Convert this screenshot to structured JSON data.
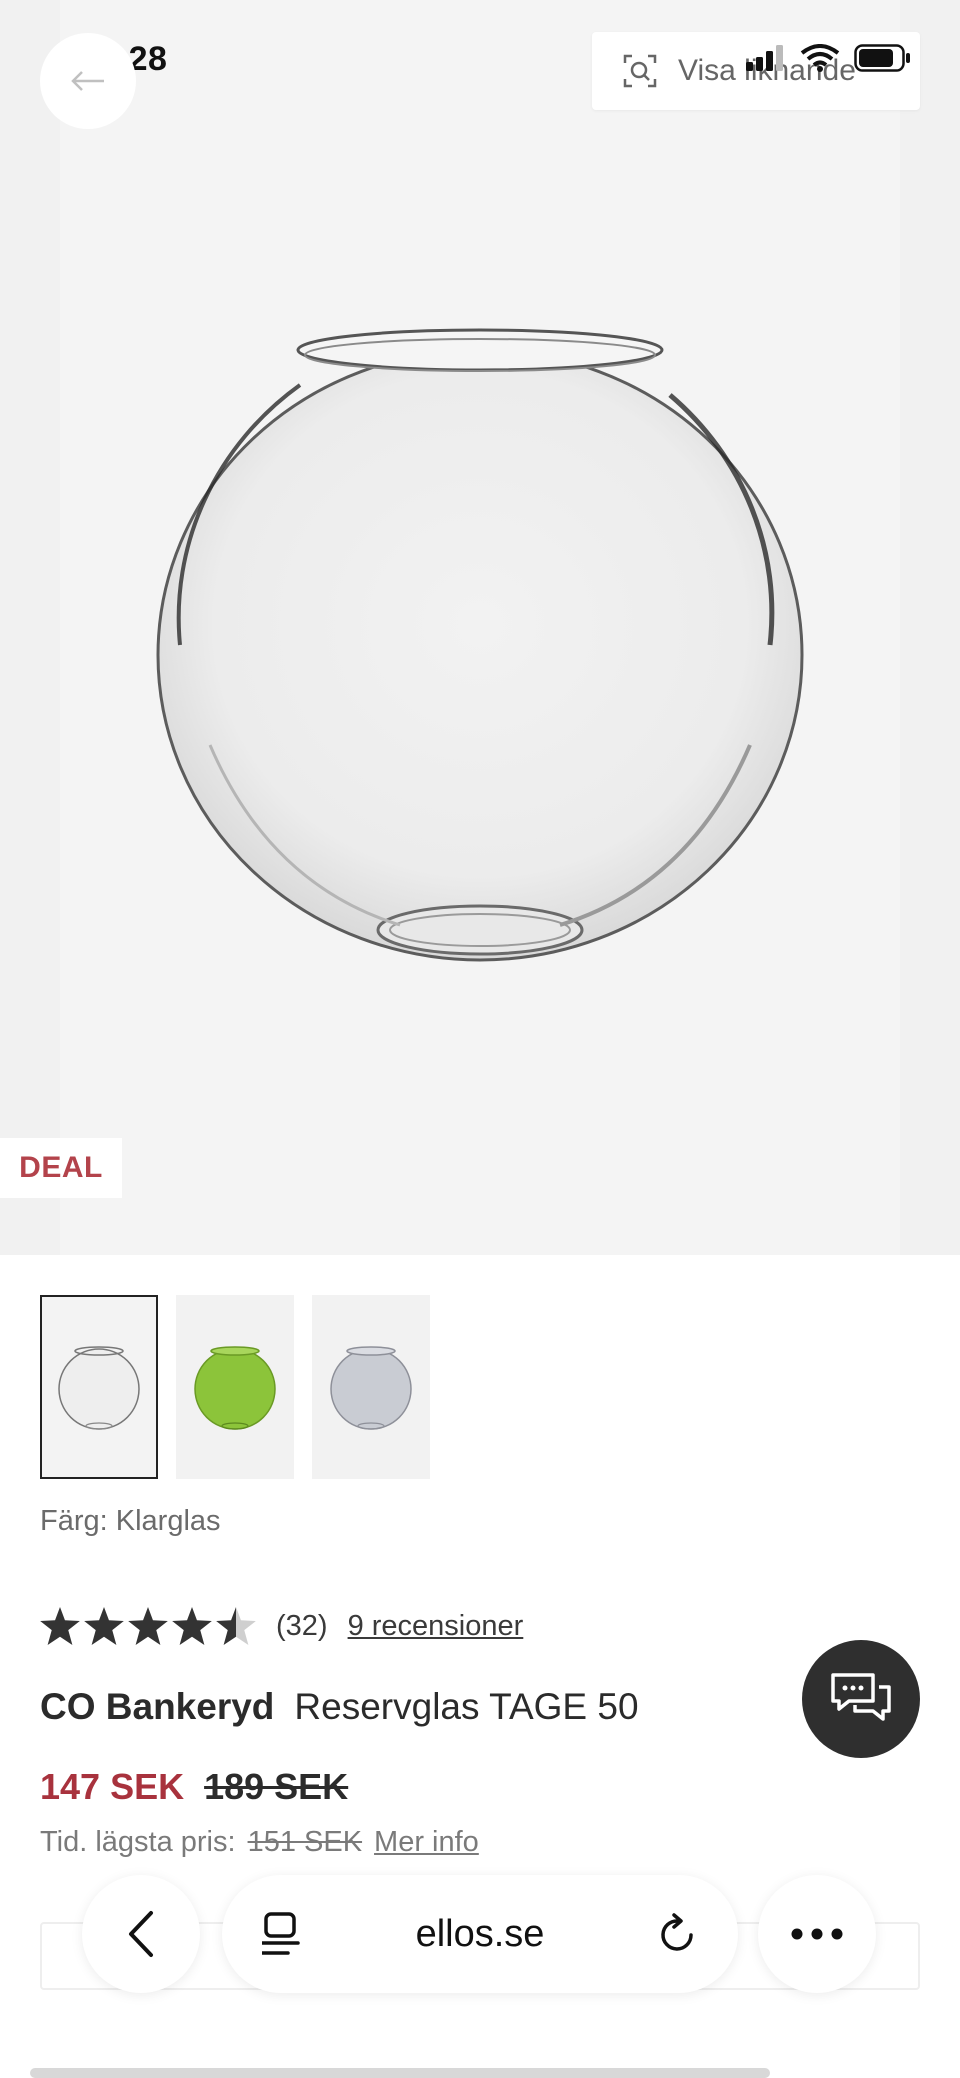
{
  "status_bar": {
    "time": "15:28"
  },
  "top": {
    "similar_label": "Visa liknande"
  },
  "badge": {
    "deal": "DEAL"
  },
  "thumbnails": [
    {
      "name": "Klarglas",
      "color": "#e9e9e9"
    },
    {
      "name": "Grön",
      "color": "#8cc43a"
    },
    {
      "name": "Grå",
      "color": "#c9ccd3"
    }
  ],
  "color_label": "Färg: Klarglas",
  "rating": {
    "stars": 4.5,
    "count_text": "(32)",
    "reviews_link": "9 recensioner"
  },
  "product": {
    "brand": "CO Bankeryd",
    "name": "Reservglas TAGE 50"
  },
  "price": {
    "current": "147 SEK",
    "original": "189 SEK"
  },
  "lowest_price": {
    "label": "Tid. lägsta pris:",
    "value": "151 SEK",
    "more_info": "Mer info"
  },
  "browser": {
    "url": "ellos.se"
  },
  "colors": {
    "sale_red": "#a8323d",
    "deal_red": "#b3434b",
    "chat_bg": "#2f2f2f"
  }
}
